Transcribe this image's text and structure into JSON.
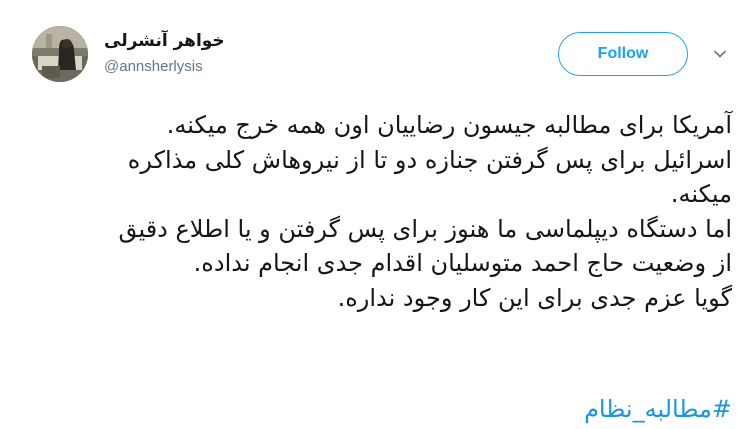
{
  "tweet": {
    "author": {
      "display_name": "خواهر آنشرلی",
      "handle": "@annsherlysis",
      "avatar_icon": "profile-photo"
    },
    "follow_label": "Follow",
    "menu_icon": "chevron-down-icon",
    "body_lines": [
      "آمریکا برای مطالبه جیسون رضاییان اون همه خرج میکنه.",
      "اسرائیل برای پس گرفتن جنازه دو تا از نیروهاش کلی مذاکره",
      "میکنه.",
      "اما دستگاه دیپلماسی ما هنوز برای پس گرفتن و یا اطلاع دقیق",
      "از وضعیت حاج احمد متوسلیان اقدام جدی انجام نداده.",
      "گویا عزم جدی برای این کار وجود نداره."
    ],
    "hashtag": "#مطالبه_نظام"
  },
  "colors": {
    "accent": "#1da1f2",
    "link": "#1b95e0",
    "text": "#14171a",
    "secondary_text": "#657786"
  }
}
